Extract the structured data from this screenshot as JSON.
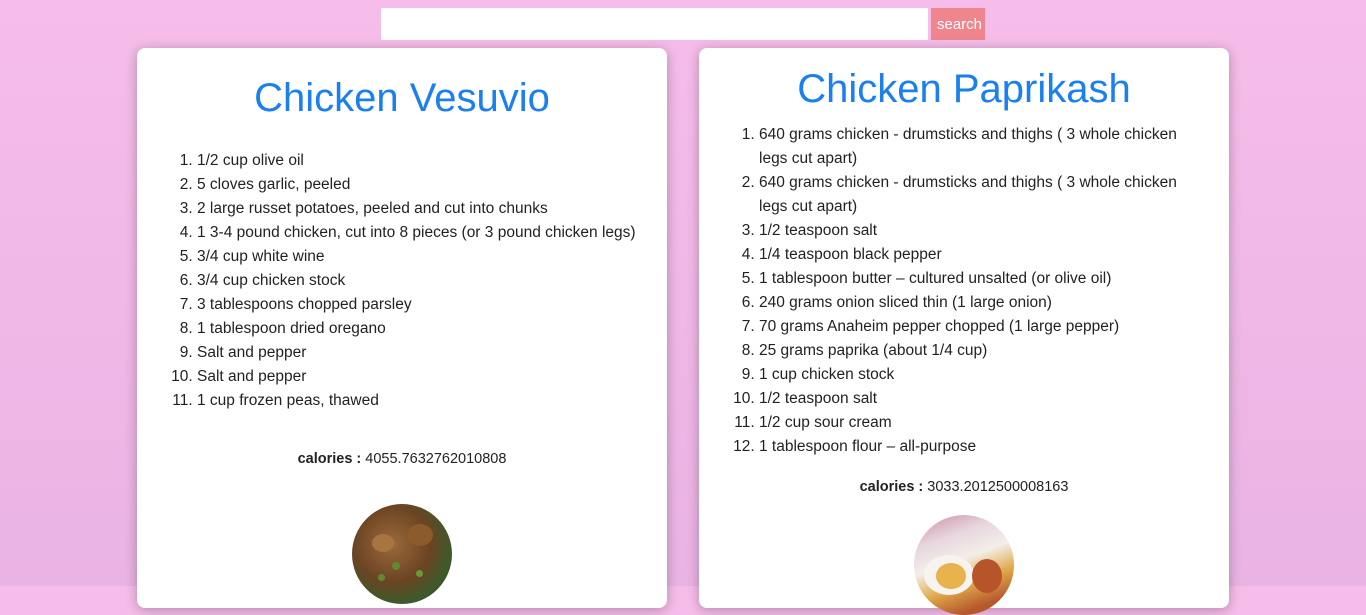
{
  "search": {
    "placeholder": "",
    "value": "",
    "button_label": "search"
  },
  "recipes": [
    {
      "title": "Chicken Vesuvio",
      "ingredients": [
        "1/2 cup olive oil",
        "5 cloves garlic, peeled",
        "2 large russet potatoes, peeled and cut into chunks",
        "1 3-4 pound chicken, cut into 8 pieces (or 3 pound chicken legs)",
        "3/4 cup white wine",
        "3/4 cup chicken stock",
        "3 tablespoons chopped parsley",
        "1 tablespoon dried oregano",
        "Salt and pepper",
        "Salt and pepper",
        "1 cup frozen peas, thawed"
      ],
      "calories_label": "calories :",
      "calories_value": "4055.7632762010808",
      "image": "chicken-vesuvio-photo"
    },
    {
      "title": "Chicken Paprikash",
      "ingredients": [
        "640 grams chicken - drumsticks and thighs ( 3 whole chicken legs cut apart)",
        "640 grams chicken - drumsticks and thighs ( 3 whole chicken legs cut apart)",
        "1/2 teaspoon salt",
        "1/4 teaspoon black pepper",
        "1 tablespoon butter – cultured unsalted (or olive oil)",
        "240 grams onion sliced thin (1 large onion)",
        "70 grams Anaheim pepper chopped (1 large pepper)",
        "25 grams paprika (about 1/4 cup)",
        "1 cup chicken stock",
        "1/2 teaspoon salt",
        "1/2 cup sour cream",
        "1 tablespoon flour – all-purpose"
      ],
      "calories_label": "calories :",
      "calories_value": "3033.2012500008163",
      "image": "chicken-paprikash-photo"
    }
  ]
}
